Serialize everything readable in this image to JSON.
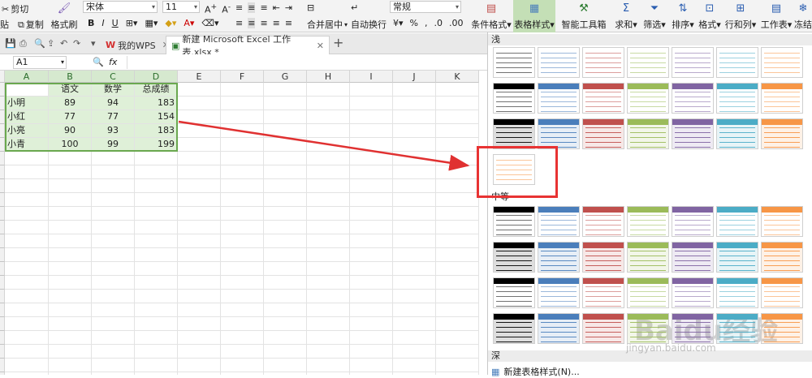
{
  "ribbon": {
    "paste_fragment": "贴",
    "cut": "剪切",
    "copy": "复制",
    "format_painter": "格式刷",
    "font_name": "宋体",
    "font_size": "11",
    "number_format": "常规",
    "merge_center": "合并居中",
    "wrap_text": "自动换行",
    "conditional_format": "条件格式",
    "table_style": "表格样式",
    "smart_toolbox": "智能工具箱",
    "sum": "求和",
    "filter": "筛选",
    "sort": "排序",
    "format": "格式",
    "rows_cols": "行和列",
    "worksheet": "工作表",
    "freeze": "冻结",
    "bold": "B",
    "italic": "I",
    "underline": "U"
  },
  "tabs": {
    "home": "我的WPS",
    "file": "新建 Microsoft Excel 工作表.xlsx *",
    "add": "+"
  },
  "formula_bar": {
    "name_box": "A1",
    "fx": "fx"
  },
  "sheet": {
    "columns": [
      "A",
      "B",
      "C",
      "D",
      "E",
      "F",
      "G",
      "H",
      "I",
      "J",
      "K"
    ],
    "headers": [
      "",
      "语文",
      "数学",
      "总成绩"
    ],
    "rows": [
      [
        "小明",
        "89",
        "94",
        "183"
      ],
      [
        "小红",
        "77",
        "77",
        "154"
      ],
      [
        "小亮",
        "90",
        "93",
        "183"
      ],
      [
        "小青",
        "100",
        "99",
        "199"
      ]
    ]
  },
  "panel": {
    "section_light": "浅",
    "section_medium": "中等",
    "section_dark": "深",
    "new_style": "新建表格样式(N)...",
    "watermark": "Baidu经验",
    "watermark_url": "jingyan.baidu.com"
  },
  "colors": {
    "accent_green": "#6aa84f",
    "selection_fill": "#dff0d8",
    "highlight_red": "#e83333",
    "swatch_palette": [
      "#000000",
      "#4a7ebb",
      "#c0504d",
      "#9bbb59",
      "#8064a2",
      "#4bacc6",
      "#f79646"
    ]
  }
}
